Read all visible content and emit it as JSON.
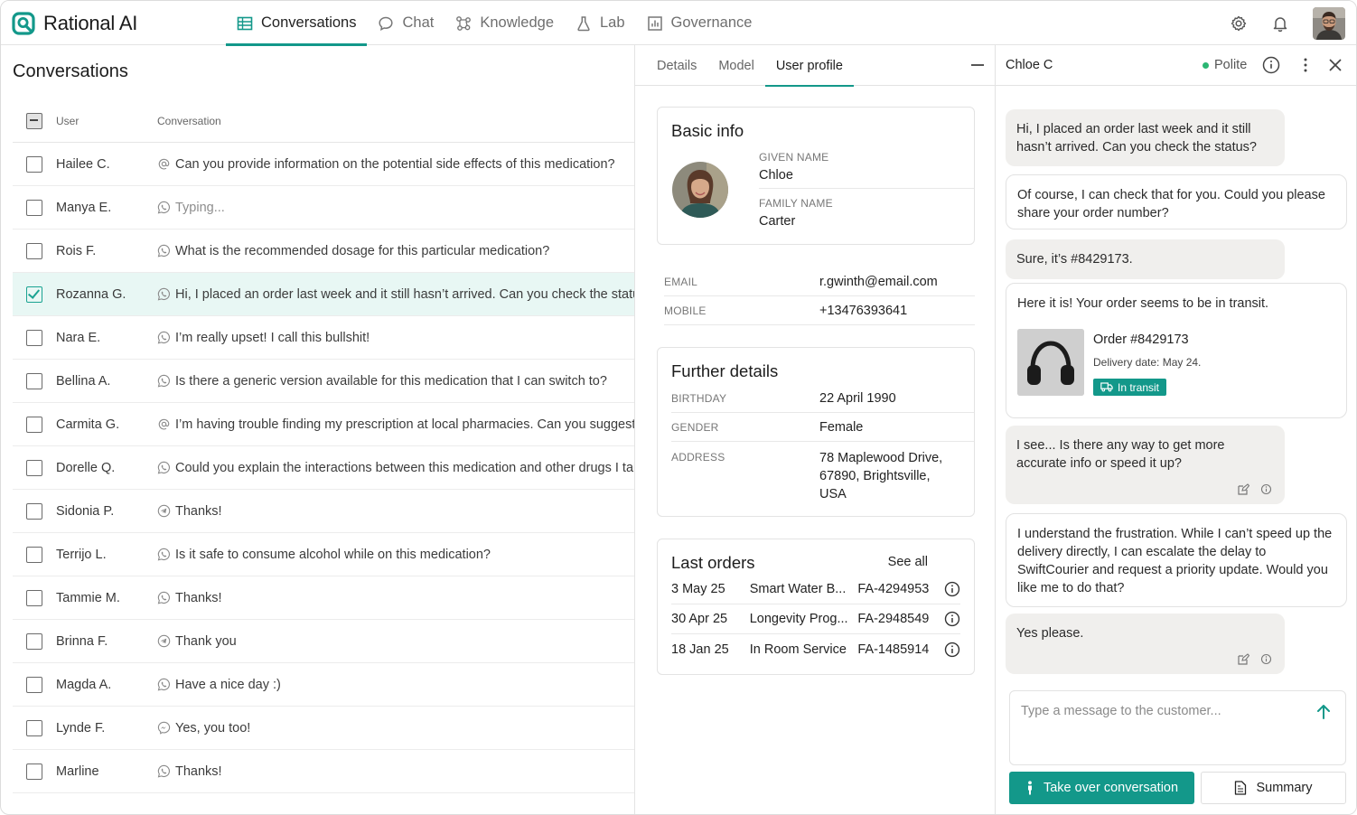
{
  "brand": {
    "name": "Rational AI"
  },
  "nav": [
    {
      "label": "Conversations",
      "icon": "table-icon",
      "active": true
    },
    {
      "label": "Chat",
      "icon": "chat-bubble-icon"
    },
    {
      "label": "Knowledge",
      "icon": "graph-icon"
    },
    {
      "label": "Lab",
      "icon": "flask-icon"
    },
    {
      "label": "Governance",
      "icon": "chart-box-icon"
    }
  ],
  "conversations": {
    "title": "Conversations",
    "headers": {
      "user": "User",
      "conversation": "Conversation"
    },
    "rows": [
      {
        "user": "Hailee C.",
        "channel": "at-icon",
        "message": "Can you provide information on the potential side effects of this medication?"
      },
      {
        "user": "Manya E.",
        "channel": "whatsapp-icon",
        "message": "Typing...",
        "muted": true
      },
      {
        "user": "Rois F.",
        "channel": "whatsapp-icon",
        "message": "What is the recommended dosage for this particular medication?"
      },
      {
        "user": "Rozanna G.",
        "channel": "whatsapp-icon",
        "message": "Hi, I placed an order last week and it still hasn’t arrived. Can you check the status?",
        "selected": true
      },
      {
        "user": "Nara E.",
        "channel": "whatsapp-icon",
        "message": "I’m really upset! I call this bullshit!"
      },
      {
        "user": "Bellina A.",
        "channel": "whatsapp-icon",
        "message": "Is there a generic version available for this medication that I can switch to?"
      },
      {
        "user": "Carmita G.",
        "channel": "at-icon",
        "message": "I’m having trouble finding my prescription at local pharmacies. Can you suggest alternatives?"
      },
      {
        "user": "Dorelle Q.",
        "channel": "whatsapp-icon",
        "message": "Could you explain the interactions between this medication and other drugs I take?"
      },
      {
        "user": "Sidonia P.",
        "channel": "telegram-icon",
        "message": "Thanks!"
      },
      {
        "user": "Terrijo L.",
        "channel": "whatsapp-icon",
        "message": "Is it safe to consume alcohol while on this medication?"
      },
      {
        "user": "Tammie M.",
        "channel": "whatsapp-icon",
        "message": "Thanks!"
      },
      {
        "user": "Brinna F.",
        "channel": "telegram-icon",
        "message": "Thank you"
      },
      {
        "user": "Magda A.",
        "channel": "whatsapp-icon",
        "message": "Have a nice day :)"
      },
      {
        "user": "Lynde F.",
        "channel": "messenger-icon",
        "message": "Yes, you too!"
      },
      {
        "user": "Marline",
        "channel": "whatsapp-icon",
        "message": "Thanks!"
      }
    ]
  },
  "profile": {
    "tabs": [
      {
        "label": "Details"
      },
      {
        "label": "Model"
      },
      {
        "label": "User profile",
        "active": true
      }
    ],
    "basic": {
      "title": "Basic info",
      "given_label": "GIVEN NAME",
      "given": "Chloe",
      "family_label": "FAMILY NAME",
      "family": "Carter"
    },
    "contact": {
      "email_label": "EMAIL",
      "email": "r.gwinth@email.com",
      "mobile_label": "MOBILE",
      "mobile": "+13476393641"
    },
    "further": {
      "title": "Further details",
      "birthday_label": "BIRTHDAY",
      "birthday": "22 April 1990",
      "gender_label": "GENDER",
      "gender": "Female",
      "address_label": "ADDRESS",
      "address_lines": [
        "78 Maplewood Drive,",
        "67890, Brightsville,",
        "USA"
      ]
    },
    "orders": {
      "title": "Last orders",
      "see_all": "See all",
      "rows": [
        {
          "date": "3 May 25",
          "item": "Smart Water B...",
          "id": "FA-4294953"
        },
        {
          "date": "30 Apr 25",
          "item": "Longevity Prog...",
          "id": "FA-2948549"
        },
        {
          "date": "18 Jan 25",
          "item": "In Room Service",
          "id": "FA-1485914"
        }
      ]
    }
  },
  "chat": {
    "name": "Chloe C",
    "sentiment": "Polite",
    "messages": [
      {
        "from": "customer",
        "text": "Hi, I placed an order last week and it still hasn’t arrived. Can you check the status?"
      },
      {
        "from": "agent",
        "text": "Of course, I can check that for you. Could you please share your order number?"
      },
      {
        "from": "customer",
        "text": "Sure, it’s #8429173."
      },
      {
        "from": "agent",
        "text": "Here it is! Your order seems to be in transit."
      },
      {
        "from": "customer",
        "text": "I see... Is there any way to get more accurate info or speed it up?"
      },
      {
        "from": "agent",
        "text": "I understand the frustration. While I can’t speed up the delivery directly, I can escalate the delay to SwiftCourier and request a priority update. Would you like me to do that?"
      },
      {
        "from": "customer",
        "text": "Yes please."
      }
    ],
    "order_card": {
      "title": "Order #8429173",
      "delivery": "Delivery date: May 24.",
      "status": "In transit"
    },
    "composer_placeholder": "Type a message to the customer...",
    "take_over_label": "Take over conversation",
    "summary_label": "Summary"
  },
  "colors": {
    "accent": "#13988a",
    "selected_row": "#e8f7f4",
    "customer_bubble": "#f0efed",
    "online": "#2bb673"
  }
}
